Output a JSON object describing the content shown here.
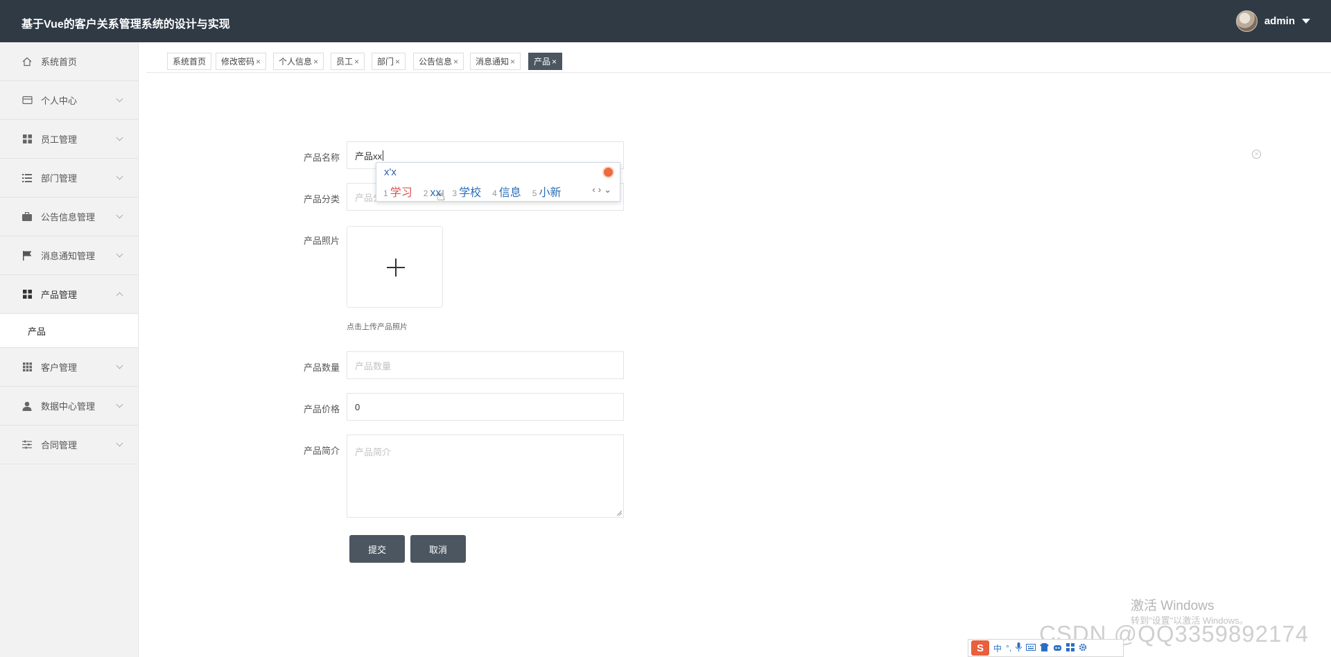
{
  "header": {
    "title": "基于Vue的客户关系管理系统的设计与实现",
    "username": "admin"
  },
  "sidebar": {
    "items": [
      {
        "label": "系统首页",
        "icon": "home-icon"
      },
      {
        "label": "个人中心",
        "icon": "card-icon"
      },
      {
        "label": "员工管理",
        "icon": "grid-icon"
      },
      {
        "label": "部门管理",
        "icon": "list-icon"
      },
      {
        "label": "公告信息管理",
        "icon": "briefcase-icon"
      },
      {
        "label": "消息通知管理",
        "icon": "flag-icon"
      },
      {
        "label": "产品管理",
        "icon": "grid-icon"
      },
      {
        "label": "客户管理",
        "icon": "apps-icon"
      },
      {
        "label": "数据中心管理",
        "icon": "user-icon"
      },
      {
        "label": "合同管理",
        "icon": "sliders-icon"
      }
    ],
    "submenu_label": "产品"
  },
  "tabs": [
    "系统首页",
    "修改密码",
    "个人信息",
    "员工",
    "部门",
    "公告信息",
    "消息通知",
    "产品"
  ],
  "tab_close": "×",
  "form": {
    "name_label": "产品名称",
    "name_value": "产品xx",
    "category_label": "产品分类",
    "category_placeholder": "产品分类",
    "photo_label": "产品照片",
    "photo_hint": "点击上传产品照片",
    "quantity_label": "产品数量",
    "quantity_placeholder": "产品数量",
    "price_label": "产品价格",
    "price_value": "0",
    "intro_label": "产品简介",
    "intro_placeholder": "产品简介",
    "submit": "提交",
    "cancel": "取消"
  },
  "ime": {
    "composition": "x'x",
    "candidates": [
      {
        "num": "1",
        "text": "学习"
      },
      {
        "num": "2",
        "text": "xx"
      },
      {
        "num": "3",
        "text": "学校"
      },
      {
        "num": "4",
        "text": "信息"
      },
      {
        "num": "5",
        "text": "小新"
      }
    ],
    "toolbar_mode": "中",
    "toolbar_punct": "°,"
  },
  "watermark": {
    "line1": "激活 Windows",
    "line2": "转到\"设置\"以激活 Windows。",
    "csdn": "CSDN @QQ3359892174"
  },
  "colors": {
    "header_bg": "#2f3a45",
    "accent": "#4b5661"
  }
}
